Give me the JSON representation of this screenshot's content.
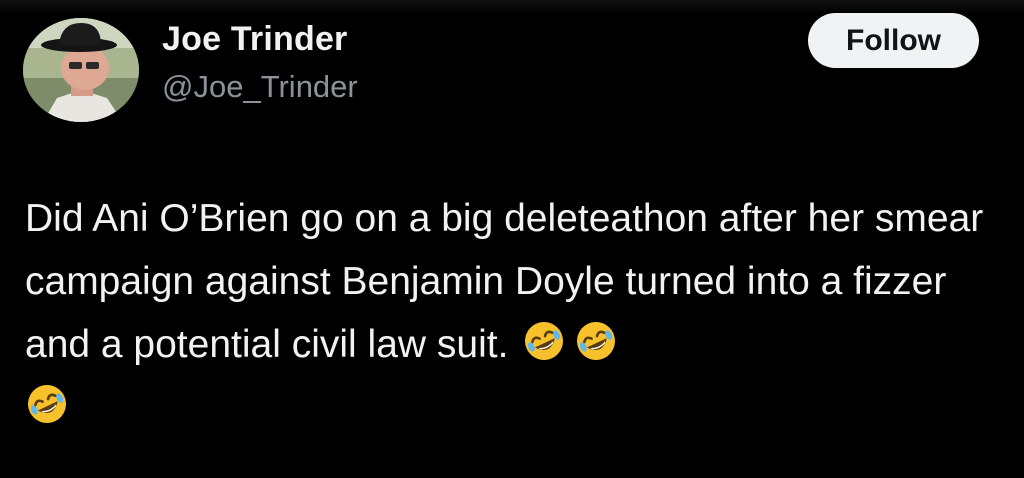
{
  "tweet": {
    "author": {
      "display_name": "Joe Trinder",
      "handle": "@Joe_Trinder",
      "avatar_icon": "profile-photo-man-bowler-hat"
    },
    "follow_button": {
      "label": "Follow"
    },
    "text": "Did Ani O’Brien go on a big deleteathon after her smear campaign against Benjamin Doyle turned into a fizzer and a potential civil law suit.",
    "emojis": [
      {
        "name": "rolling-on-the-floor-laughing-icon",
        "glyph": "🤣"
      },
      {
        "name": "rolling-on-the-floor-laughing-icon",
        "glyph": "🤣"
      },
      {
        "name": "rolling-on-the-floor-laughing-icon",
        "glyph": "🤣"
      }
    ]
  },
  "colors": {
    "background": "#000000",
    "primary_text": "#f2f2f2",
    "secondary_text": "#8b9299",
    "follow_button_bg": "#eff3f4",
    "follow_button_text": "#0f1419",
    "emoji_face": "#f7c12b"
  }
}
